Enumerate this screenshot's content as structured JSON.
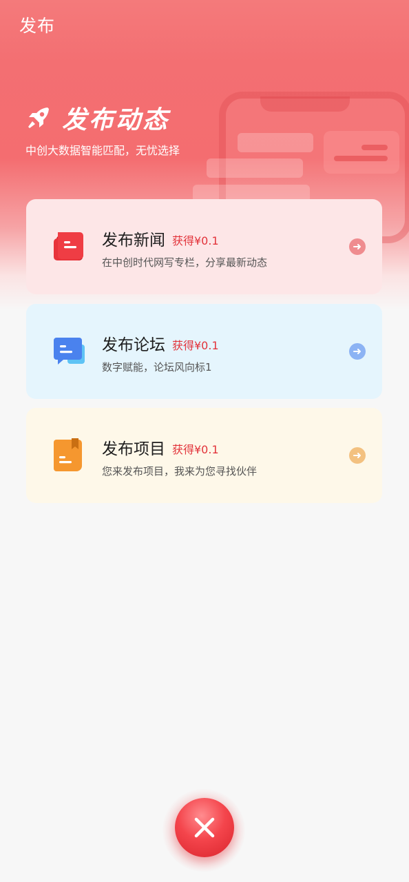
{
  "header": {
    "title": "发布"
  },
  "hero": {
    "title": "发布动态",
    "subtitle": "中创大数据智能匹配，无忧选择",
    "icon": "rocket-icon"
  },
  "cards": [
    {
      "title": "发布新闻",
      "reward": "获得¥0.1",
      "description": "在中创时代网写专栏，分享最新动态",
      "icon": "news-icon",
      "accent": "#e8343b"
    },
    {
      "title": "发布论坛",
      "reward": "获得¥0.1",
      "description": "数字赋能，论坛风向标1",
      "icon": "forum-icon",
      "accent": "#4a82ee"
    },
    {
      "title": "发布项目",
      "reward": "获得¥0.1",
      "description": "您来发布项目，我来为您寻找伙伴",
      "icon": "project-icon",
      "accent": "#f5972f"
    }
  ],
  "close_button": {
    "icon": "close-icon"
  },
  "colors": {
    "brand_red": "#f36f72",
    "reward_red": "#e2333a"
  }
}
